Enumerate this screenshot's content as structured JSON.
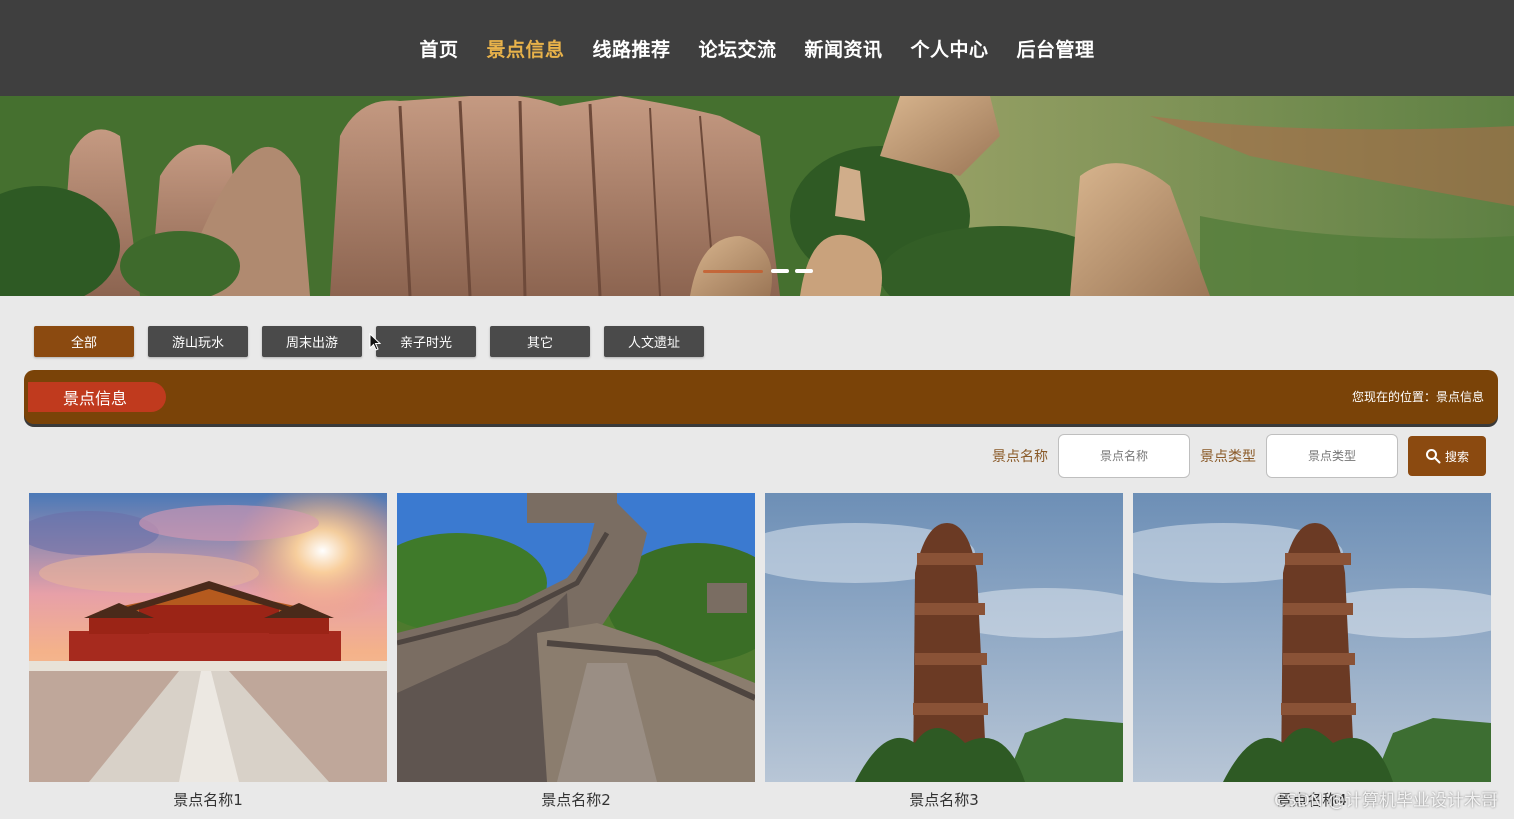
{
  "nav": {
    "items": [
      "首页",
      "景点信息",
      "线路推荐",
      "论坛交流",
      "新闻资讯",
      "个人中心",
      "后台管理"
    ],
    "active_index": 1
  },
  "categories": {
    "items": [
      "全部",
      "游山玩水",
      "周末出游",
      "亲子时光",
      "其它",
      "人文遗址"
    ],
    "active_index": 0
  },
  "section": {
    "title": "景点信息",
    "breadcrumb": "您现在的位置：景点信息"
  },
  "search": {
    "name_label": "景点名称",
    "name_placeholder": "景点名称",
    "type_label": "景点类型",
    "type_placeholder": "景点类型",
    "button_label": "搜索",
    "button_icon": "search-icon"
  },
  "cards": [
    {
      "title": "景点名称1",
      "image": "palace"
    },
    {
      "title": "景点名称2",
      "image": "great-wall"
    },
    {
      "title": "景点名称3",
      "image": "totem"
    },
    {
      "title": "景点名称4",
      "image": "totem"
    }
  ],
  "watermark": "CSDN @计算机毕业设计木哥",
  "colors": {
    "nav_bg": "#3f3f3f",
    "nav_active": "#e8b24a",
    "accent_brown": "#8b4a10",
    "section_bg": "#7a4308",
    "section_title_bg": "#c03a1e",
    "button_dark": "#4a4a4a"
  }
}
